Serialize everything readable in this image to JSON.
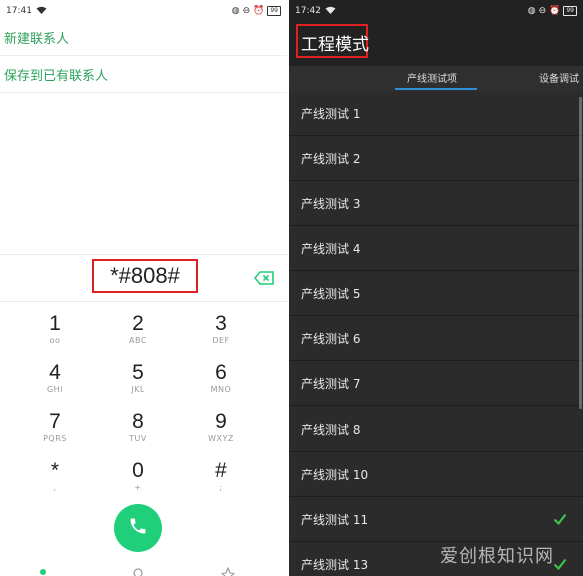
{
  "left": {
    "status": {
      "time": "17:41",
      "battery": "99"
    },
    "menu": {
      "new_contact": "新建联系人",
      "save_existing": "保存到已有联系人"
    },
    "dial_number": "*#808#",
    "keys": [
      {
        "digit": "1",
        "letters": "oo"
      },
      {
        "digit": "2",
        "letters": "ABC"
      },
      {
        "digit": "3",
        "letters": "DEF"
      },
      {
        "digit": "4",
        "letters": "GHI"
      },
      {
        "digit": "5",
        "letters": "JKL"
      },
      {
        "digit": "6",
        "letters": "MNO"
      },
      {
        "digit": "7",
        "letters": "PQRS"
      },
      {
        "digit": "8",
        "letters": "TUV"
      },
      {
        "digit": "9",
        "letters": "WXYZ"
      },
      {
        "digit": "*",
        "letters": ","
      },
      {
        "digit": "0",
        "letters": "+"
      },
      {
        "digit": "#",
        "letters": ";"
      }
    ],
    "accent_color": "#1fcf7a"
  },
  "right": {
    "status": {
      "time": "17:42",
      "battery": "99"
    },
    "title": "工程模式",
    "tabs": [
      "产线测试项",
      "设备调试"
    ],
    "items": [
      {
        "label": "产线测试 1",
        "checked": false
      },
      {
        "label": "产线测试 2",
        "checked": false
      },
      {
        "label": "产线测试 3",
        "checked": false
      },
      {
        "label": "产线测试 4",
        "checked": false
      },
      {
        "label": "产线测试 5",
        "checked": false
      },
      {
        "label": "产线测试 6",
        "checked": false
      },
      {
        "label": "产线测试 7",
        "checked": false
      },
      {
        "label": "产线测试 8",
        "checked": false
      },
      {
        "label": "产线测试 10",
        "checked": false
      },
      {
        "label": "产线测试 11",
        "checked": true
      },
      {
        "label": "产线测试 13",
        "checked": true
      }
    ],
    "check_color": "#3cc24a"
  },
  "watermark": "爱创根知识网"
}
